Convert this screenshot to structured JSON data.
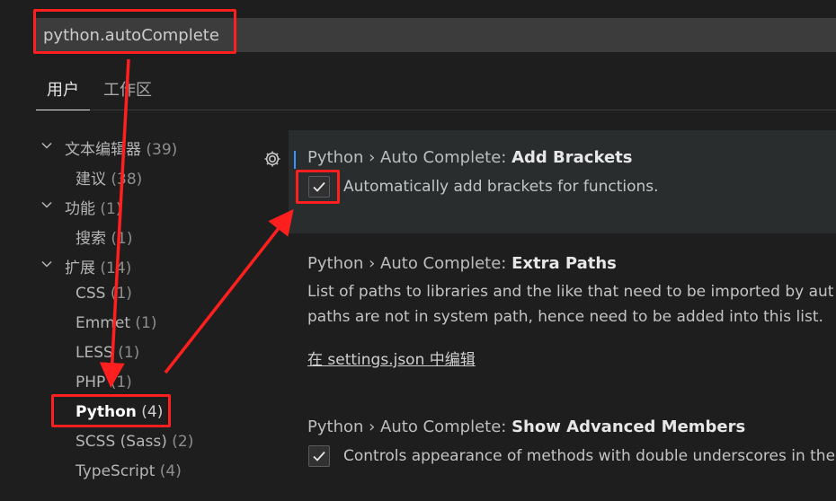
{
  "search": {
    "value": "python.autoComplete"
  },
  "tabs": [
    {
      "label": "用户",
      "active": true
    },
    {
      "label": "工作区",
      "active": false
    }
  ],
  "toc": [
    {
      "name": "文本编辑器",
      "count": "(39)",
      "expanded": true,
      "level": 0
    },
    {
      "name": "建议",
      "count": "(38)",
      "level": 1
    },
    {
      "name": "功能",
      "count": "(1)",
      "expanded": true,
      "level": 0
    },
    {
      "name": "搜索",
      "count": "(1)",
      "level": 1
    },
    {
      "name": "扩展",
      "count": "(14)",
      "expanded": true,
      "level": 0
    },
    {
      "name": "CSS",
      "count": "(1)",
      "level": 1
    },
    {
      "name": "Emmet",
      "count": "(1)",
      "level": 1
    },
    {
      "name": "LESS",
      "count": "(1)",
      "level": 1
    },
    {
      "name": "PHP",
      "count": "(1)",
      "level": 1
    },
    {
      "name": "Python",
      "count": "(4)",
      "level": 1,
      "active": true
    },
    {
      "name": "SCSS (Sass)",
      "count": "(2)",
      "level": 1
    },
    {
      "name": "TypeScript",
      "count": "(4)",
      "level": 1
    }
  ],
  "settings": [
    {
      "category": "Python › Auto Complete: ",
      "key": "Add Brackets",
      "description": "Automatically add brackets for functions.",
      "checked": true
    },
    {
      "category": "Python › Auto Complete: ",
      "key": "Extra Paths",
      "description_line1": "List of paths to libraries and the like that need to be imported by aut",
      "description_line2": "paths are not in system path, hence need to be added into this list.",
      "link": "在 settings.json 中编辑"
    },
    {
      "category": "Python › Auto Complete: ",
      "key": "Show Advanced Members",
      "description": "Controls appearance of methods with double underscores in the",
      "checked": true
    }
  ],
  "icons": {
    "gear": "gear-icon",
    "chevron": "chevron-down-icon",
    "check": "check-icon"
  },
  "colors": {
    "annotation": "#ff1f1f",
    "background": "#1e1e1e",
    "focus": "#3794ff"
  }
}
